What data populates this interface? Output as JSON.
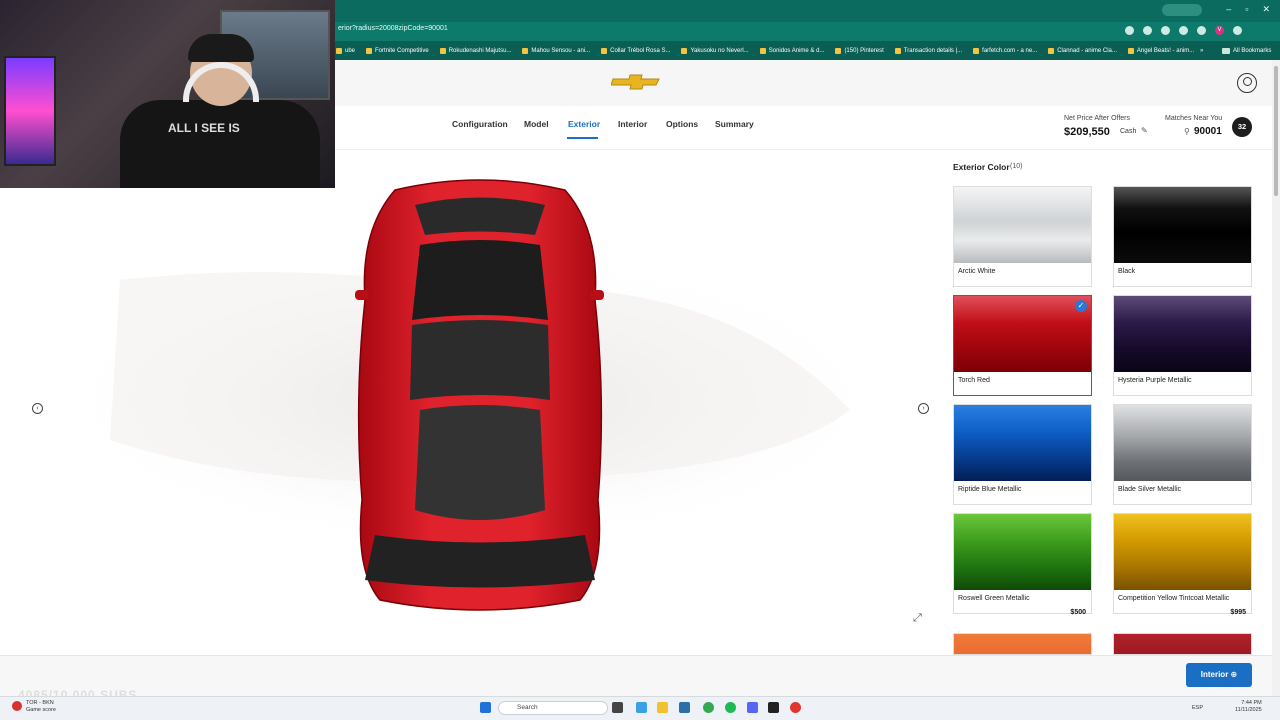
{
  "browser": {
    "url": "erior?radius=20008zipCode=90001",
    "bookmarks": [
      "ube",
      "Fortnite Competitive",
      "Rokudenashi Majutsu...",
      "Mahou Sensou - ani...",
      "Collar Trébol Rosa S...",
      "Yakusoku no Neverl...",
      "Sonidos Anime & d...",
      "(150) Pinterest",
      "Transaction details |...",
      "farfetch.com - a ne...",
      "Clannad - anime Cla...",
      "Angel Beats! - anim..."
    ],
    "all_bookmarks": "All Bookmarks",
    "overflow": "»",
    "profile_initial": "V"
  },
  "webcam": {
    "shirt_text": "ALL I SEE IS"
  },
  "header": {
    "logo": "chevrolet-bowtie-logo"
  },
  "nav": {
    "tabs": [
      "Configuration",
      "Model",
      "Exterior",
      "Interior",
      "Options",
      "Summary"
    ],
    "active": "Exterior"
  },
  "pricing": {
    "label": "Net Price After Offers",
    "value": "$209,550",
    "type": "Cash",
    "pencil_glyph": "✎",
    "matches_label": "Matches Near You",
    "zip": "90001",
    "pin_glyph": "⚲",
    "matches_count": "32"
  },
  "viewer": {
    "prev_glyph": "‹",
    "next_glyph": "›",
    "expand_glyph": "⤢"
  },
  "colors": {
    "title": "Exterior Color",
    "count": "(10)",
    "selected": "Torch Red",
    "check_glyph": "✓",
    "items": [
      {
        "name": "Arctic White",
        "price": "",
        "grad": "linear-gradient(180deg,#f4f5f6 0%,#cfd2d4 45%,#e9ebec 70%,#b9bcbf 100%)"
      },
      {
        "name": "Black",
        "price": "",
        "grad": "linear-gradient(180deg,#555 0%,#111 28%,#000 60%,#0b0b0b 100%)"
      },
      {
        "name": "Torch Red",
        "price": "",
        "grad": "linear-gradient(180deg,#e0505a 0%,#c10f18 35%,#a4050d 65%,#7c0007 100%)"
      },
      {
        "name": "Hysteria Purple Metallic",
        "price": "",
        "grad": "linear-gradient(180deg,#5d4a7a 0%,#2b1b48 35%,#160a2a 70%,#0a0515 100%)"
      },
      {
        "name": "Riptide Blue Metallic",
        "price": "",
        "grad": "linear-gradient(180deg,#2a7fe0 0%,#0e5fc6 35%,#063c8e 70%,#021f55 100%)"
      },
      {
        "name": "Blade Silver Metallic",
        "price": "",
        "grad": "linear-gradient(180deg,#dfe1e3 0%,#a7aaad 40%,#6d7074 75%,#55585c 100%)"
      },
      {
        "name": "Roswell Green Metallic",
        "price": "$500",
        "grad": "linear-gradient(180deg,#6bc63a 0%,#3e9e1e 35%,#1f7410 70%,#0f4a08 100%)"
      },
      {
        "name": "Competition Yellow Tintcoat Metallic",
        "price": "$995",
        "grad": "linear-gradient(180deg,#f0c020 0%,#d29b00 35%,#a97600 70%,#7a5200 100%)"
      }
    ]
  },
  "footer": {
    "next_button": "Interior ⊕",
    "sub_counter": "4085/10.000 SUBS"
  },
  "taskbar": {
    "weather_line1": "TOR - BKN",
    "weather_line2": "Game score",
    "search": "Search",
    "lang": "ESP",
    "time": "7:44 PM",
    "date": "11/11/2025"
  }
}
